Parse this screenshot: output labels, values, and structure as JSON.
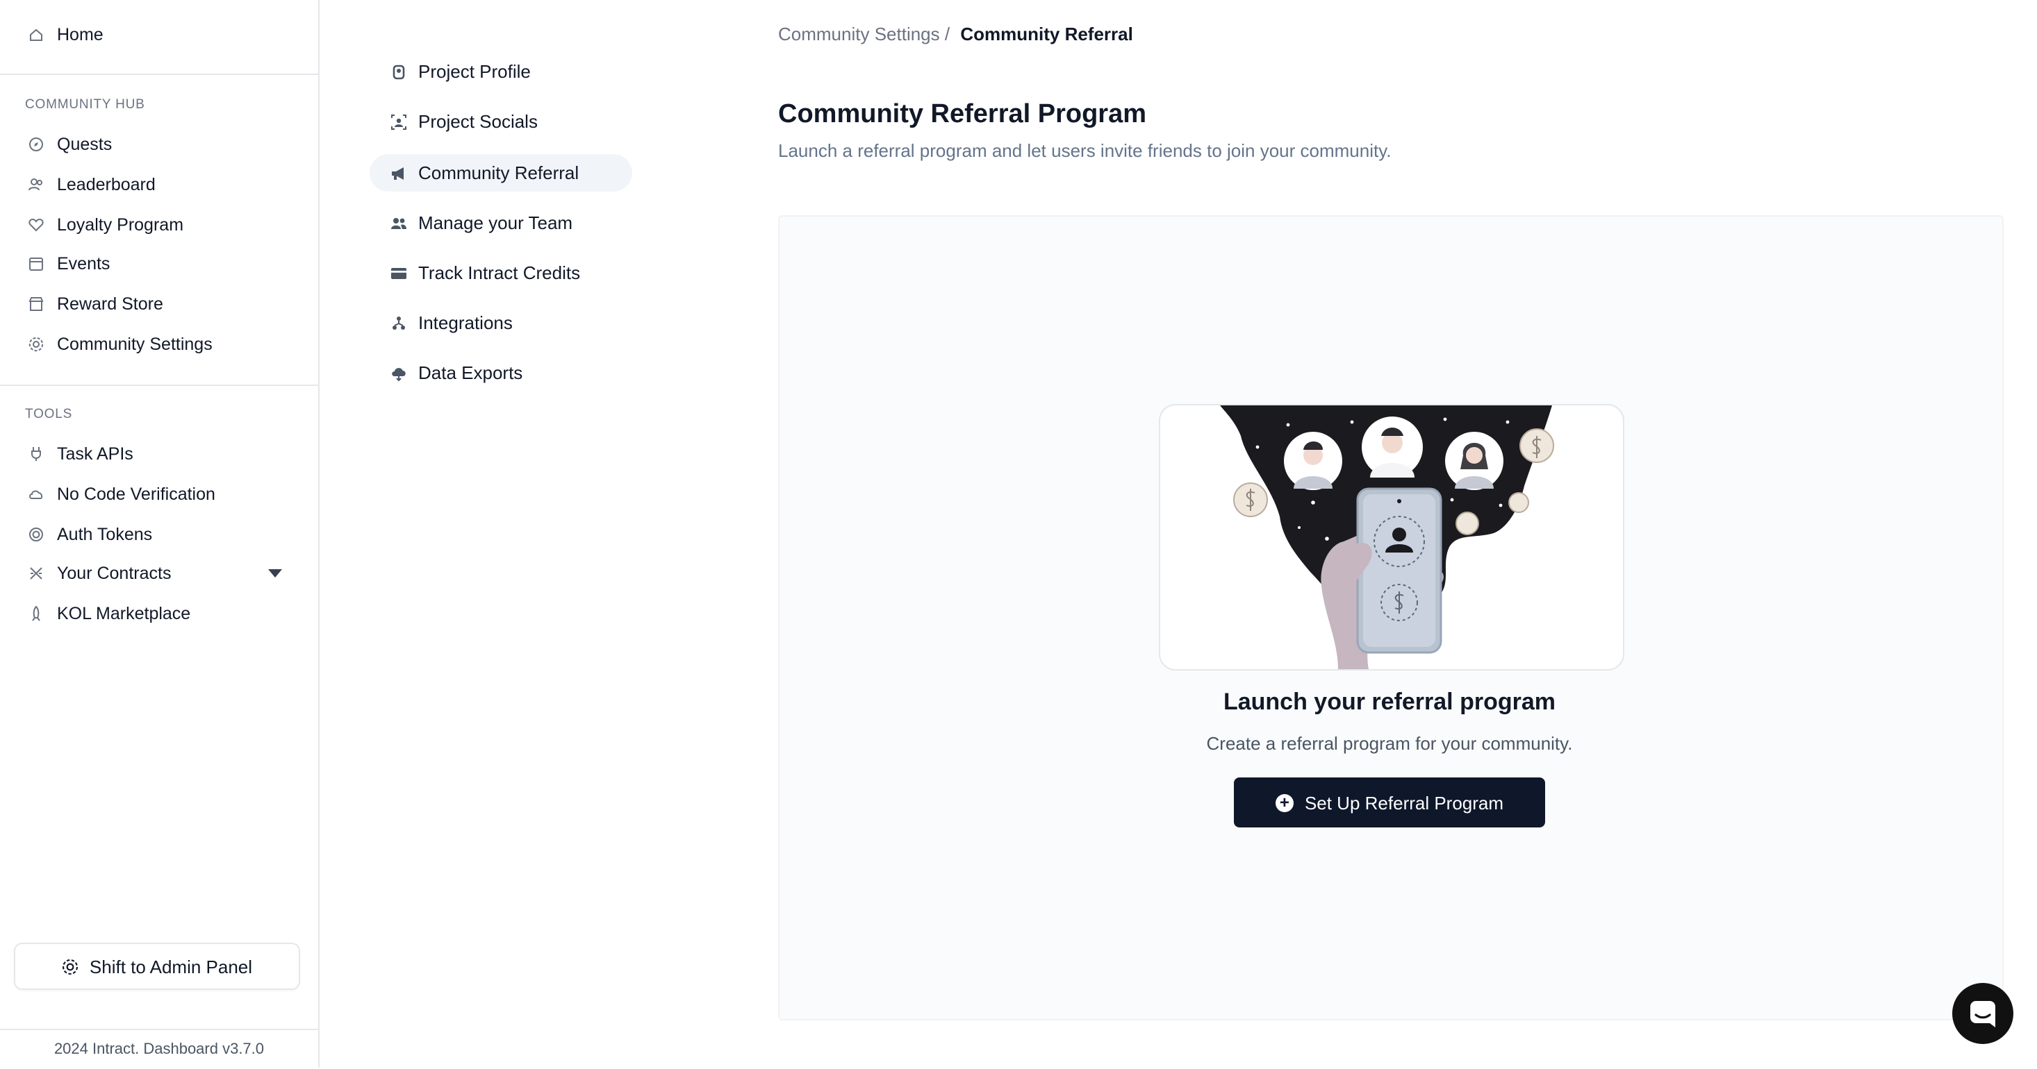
{
  "sidebar": {
    "home": "Home",
    "community_hub_label": "COMMUNITY HUB",
    "community_items": [
      {
        "label": "Quests",
        "icon": "compass-icon"
      },
      {
        "label": "Leaderboard",
        "icon": "users-icon"
      },
      {
        "label": "Loyalty Program",
        "icon": "heart-icon"
      },
      {
        "label": "Events",
        "icon": "calendar-icon"
      },
      {
        "label": "Reward Store",
        "icon": "store-icon"
      },
      {
        "label": "Community Settings",
        "icon": "gear-icon"
      }
    ],
    "tools_label": "TOOLS",
    "tools_items": [
      {
        "label": "Task APIs",
        "icon": "plug-icon"
      },
      {
        "label": "No Code Verification",
        "icon": "cloud-icon"
      },
      {
        "label": "Auth Tokens",
        "icon": "token-icon"
      },
      {
        "label": "Your Contracts",
        "icon": "contract-icon"
      },
      {
        "label": "KOL Marketplace",
        "icon": "rocket-icon"
      }
    ],
    "admin_button": "Shift to Admin Panel",
    "footer": "2024 Intract. Dashboard v3.7.0"
  },
  "settings_nav": [
    {
      "label": "Project Profile",
      "icon": "badge-icon"
    },
    {
      "label": "Project Socials",
      "icon": "socials-icon"
    },
    {
      "label": "Community Referral",
      "icon": "megaphone-icon",
      "active": true
    },
    {
      "label": "Manage your Team",
      "icon": "team-icon"
    },
    {
      "label": "Track Intract Credits",
      "icon": "card-icon"
    },
    {
      "label": "Integrations",
      "icon": "integrations-icon"
    },
    {
      "label": "Data Exports",
      "icon": "cloud-download-icon"
    }
  ],
  "breadcrumb": {
    "parent": "Community Settings /",
    "current": "Community Referral"
  },
  "main": {
    "title": "Community Referral Program",
    "subtitle": "Launch a referral program and let users invite friends to join your community.",
    "empty_title": "Launch your referral program",
    "empty_subtitle": "Create a referral program for your community.",
    "cta_label": "Set Up Referral Program"
  },
  "colors": {
    "primary": "#0f172a",
    "active_bg": "#f1f5f9",
    "muted": "#64748b"
  }
}
